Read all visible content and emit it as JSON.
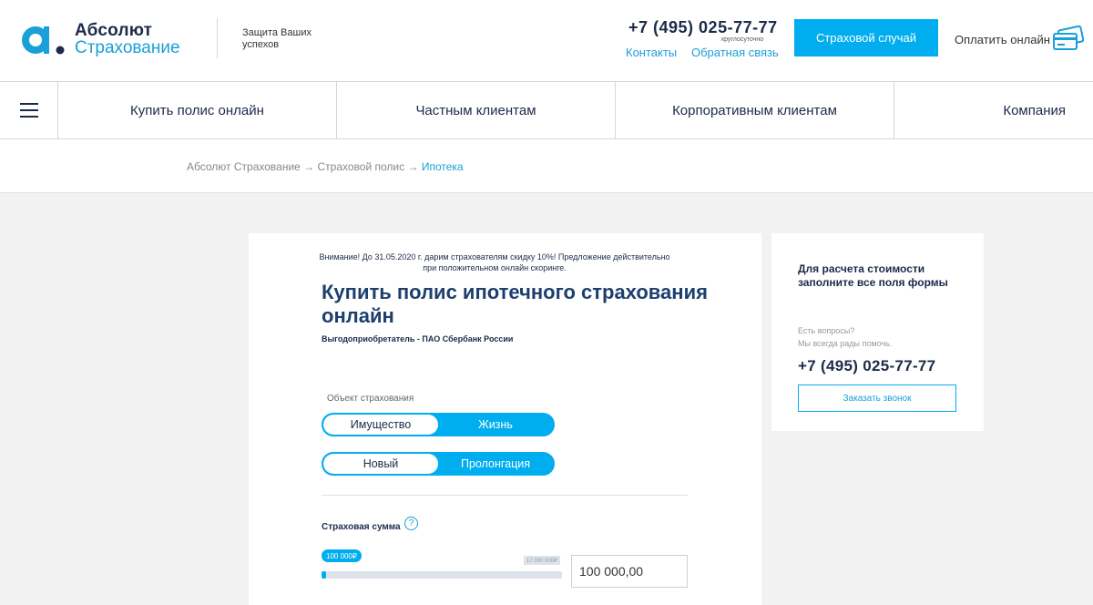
{
  "header": {
    "logo_line1": "Абсолют",
    "logo_line2": "Страхование",
    "tagline": "Защита Ваших успехов",
    "phone": "+7 (495) 025-77-77",
    "phone_note": "круглосуточно",
    "link_contacts": "Контакты",
    "link_feedback": "Обратная связь",
    "insured_event_button": "Страховой случай",
    "pay_online": "Оплатить онлайн"
  },
  "nav": {
    "items": [
      {
        "label": "Купить полис онлайн"
      },
      {
        "label": "Частным клиентам"
      },
      {
        "label": "Корпоративным клиентам"
      },
      {
        "label": "Компания"
      }
    ]
  },
  "breadcrumb": {
    "items": [
      "Абсолют Страхование",
      "Страховой полис",
      "Ипотека"
    ],
    "separator": "→"
  },
  "main": {
    "notice": "Внимание! До 31.05.2020 г. дарим страхователям скидку 10%! Предложение действительно при положительном онлайн скоринге.",
    "title": "Купить полис ипотечного страхования онлайн",
    "beneficiary": "Выгодоприобретатель - ПАО Сбербанк России",
    "object_label": "Объект страхования",
    "object_toggle": {
      "options": [
        "Имущество",
        "Жизнь"
      ],
      "selected": 0
    },
    "type_toggle": {
      "options": [
        "Новый",
        "Пролонгация"
      ],
      "selected": 0
    },
    "sum_label": "Страховая сумма",
    "help_symbol": "?",
    "slider": {
      "current_label": "100 000₽",
      "max_label": "17 000 000₽",
      "fill_fraction": 0.02
    },
    "sum_value": "100 000,00"
  },
  "sidebar": {
    "title": "Для расчета стоимости заполните все поля формы",
    "question_line1": "Есть вопросы?",
    "question_line2": "Мы всегда рады помочь.",
    "phone": "+7 (495) 025-77-77",
    "callback_button": "Заказать звонок"
  },
  "colors": {
    "accent": "#00aeef",
    "dark": "#1c2b4a",
    "link": "#1a9fd8"
  }
}
